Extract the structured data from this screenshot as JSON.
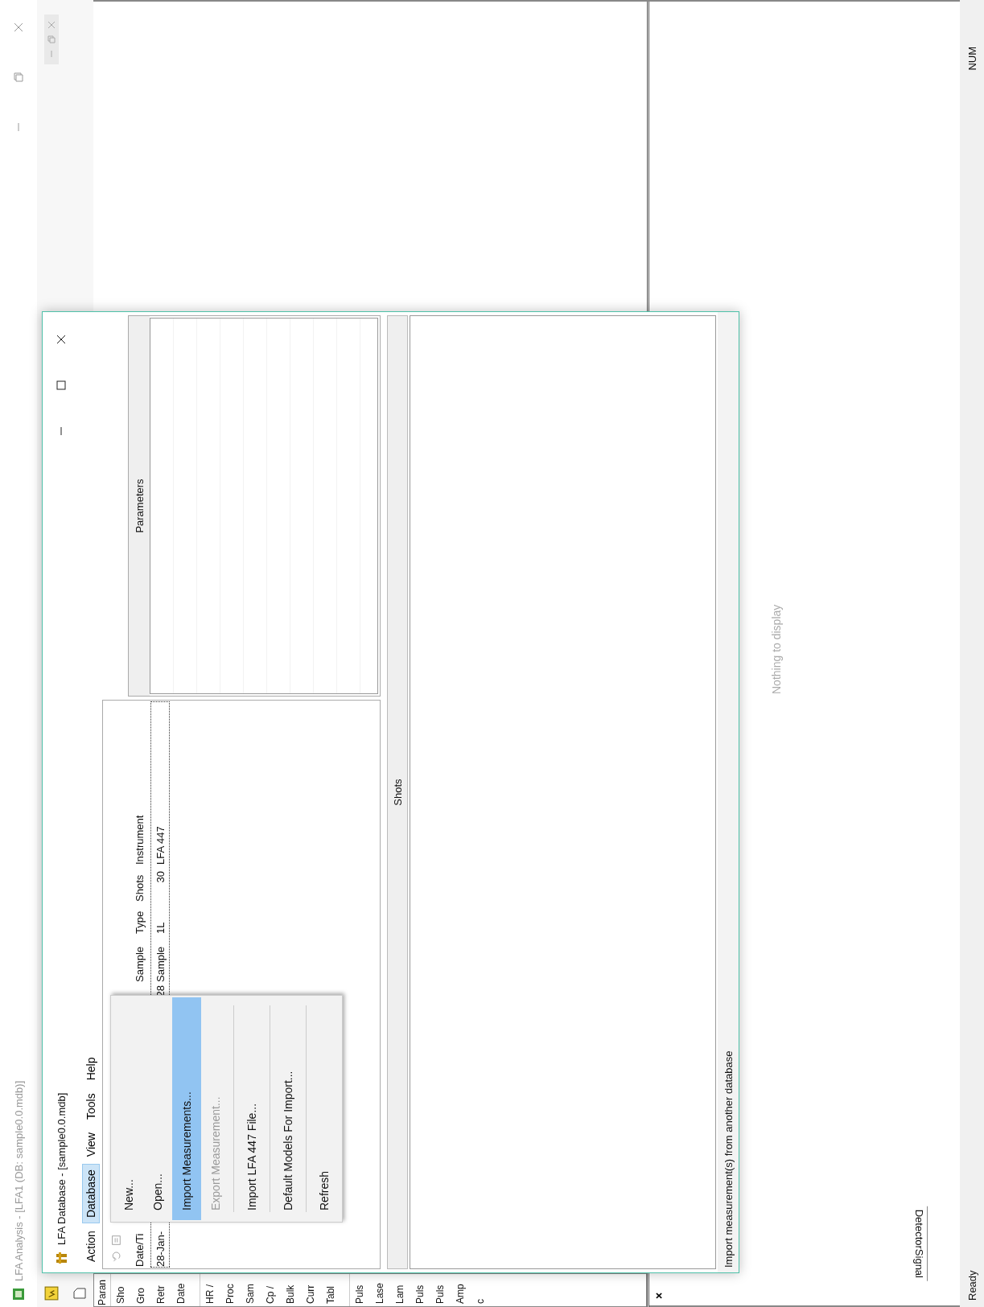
{
  "app": {
    "title": "LFA Analysis - [LFA1 (DB: sample0.0.mdb)]",
    "active": false
  },
  "left_pane": {
    "header": "Paran",
    "groups": [
      [
        "Sho",
        "Gro",
        "Retr",
        "Date"
      ],
      [
        "HR /",
        "Proc",
        "Sam",
        "Cp /",
        "Bulk",
        "Curr",
        "Tabl"
      ],
      [
        "Puls",
        "Lase",
        "Lam",
        "Puls",
        "Puls",
        "Amp",
        "c"
      ]
    ]
  },
  "dock": {
    "close_symbol": "×",
    "placeholder": "Nothing to display",
    "tabs": [
      {
        "label": "DetectorSignal",
        "selected": true
      }
    ]
  },
  "status_bar": {
    "left": "Ready",
    "right": "NUM"
  },
  "dialog": {
    "title": "LFA Database - [sample0.0.mdb]",
    "menu": [
      {
        "label": "Action",
        "selected": false
      },
      {
        "label": "Database",
        "selected": true
      },
      {
        "label": "View",
        "selected": false
      },
      {
        "label": "Tools",
        "selected": false
      },
      {
        "label": "Help",
        "selected": false
      }
    ],
    "measurements": {
      "row_selected": true,
      "fields": [
        {
          "kind": "date",
          "header": "Date/Ti",
          "value_start": "28-Jan-",
          "value_end": "28"
        },
        {
          "kind": "text",
          "header": "Sample",
          "value": "Sample"
        },
        {
          "kind": "text",
          "header": "Type",
          "value": "1L"
        },
        {
          "kind": "number",
          "header": "Shots",
          "value": "30"
        },
        {
          "kind": "text",
          "header": "Instrument",
          "value": "LFA 447"
        }
      ]
    },
    "parameters": {
      "title": "Parameters"
    },
    "shots": {
      "title": "Shots"
    },
    "status": "Import measurement(s) from another database",
    "dropdown": [
      {
        "label": "New...",
        "selected": false,
        "disabled": false,
        "separator_before": false
      },
      {
        "label": "Open...",
        "selected": false,
        "disabled": false,
        "separator_before": false
      },
      {
        "label": "Import Measurements...",
        "selected": true,
        "disabled": false,
        "separator_before": false
      },
      {
        "label": "Export Measurement...",
        "selected": false,
        "disabled": true,
        "separator_before": false
      },
      {
        "label": "Import LFA 447 File...",
        "selected": false,
        "disabled": false,
        "separator_before": true
      },
      {
        "label": "Default Models For Import...",
        "selected": false,
        "disabled": false,
        "separator_before": true
      },
      {
        "label": "Refresh",
        "selected": false,
        "disabled": false,
        "separator_before": true
      }
    ]
  }
}
